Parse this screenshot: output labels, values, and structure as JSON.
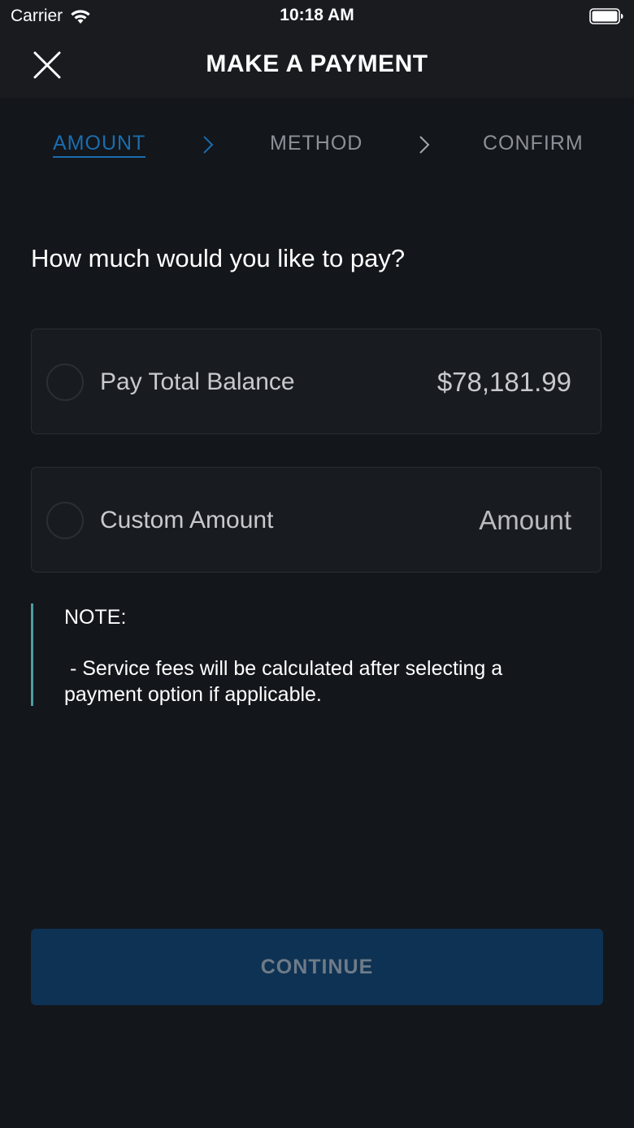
{
  "status_bar": {
    "carrier": "Carrier",
    "time": "10:18 AM"
  },
  "header": {
    "title": "MAKE A PAYMENT"
  },
  "steps": [
    {
      "label": "AMOUNT",
      "active": true
    },
    {
      "label": "METHOD",
      "active": false
    },
    {
      "label": "CONFIRM",
      "active": false
    }
  ],
  "question": "How much would you like to pay?",
  "options": {
    "total_balance": {
      "label": "Pay Total Balance",
      "value": "$78,181.99",
      "selected": false
    },
    "custom_amount": {
      "label": "Custom Amount",
      "placeholder": "Amount",
      "value": "",
      "selected": false
    }
  },
  "note": {
    "title": "NOTE:",
    "body": " - Service fees will be calculated after selecting a payment option if applicable."
  },
  "continue_label": "CONTINUE",
  "colors": {
    "background": "#13161b",
    "active_step": "#1a6dae",
    "inactive_step": "#8d9096",
    "note_accent": "#4f9ba3",
    "button_bg": "#0e3253",
    "button_text": "#6e7b88"
  }
}
